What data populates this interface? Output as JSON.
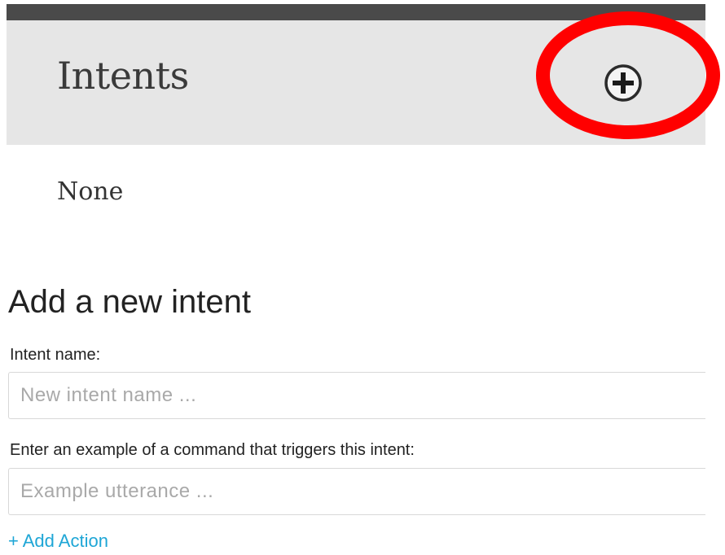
{
  "header": {
    "title": "Intents",
    "add_button_icon": "plus-circle-icon",
    "highlight_color": "#ff0000"
  },
  "intents_list": {
    "items": [
      {
        "label": "None"
      }
    ]
  },
  "new_intent_form": {
    "title": "Add a new intent",
    "name_field": {
      "label": "Intent name:",
      "placeholder": "New intent name ...",
      "value": ""
    },
    "example_field": {
      "label": "Enter an example of a command that triggers this intent:",
      "placeholder": "Example utterance ...",
      "value": ""
    },
    "add_action_label": "+ Add Action",
    "link_color": "#1ea6d6"
  }
}
